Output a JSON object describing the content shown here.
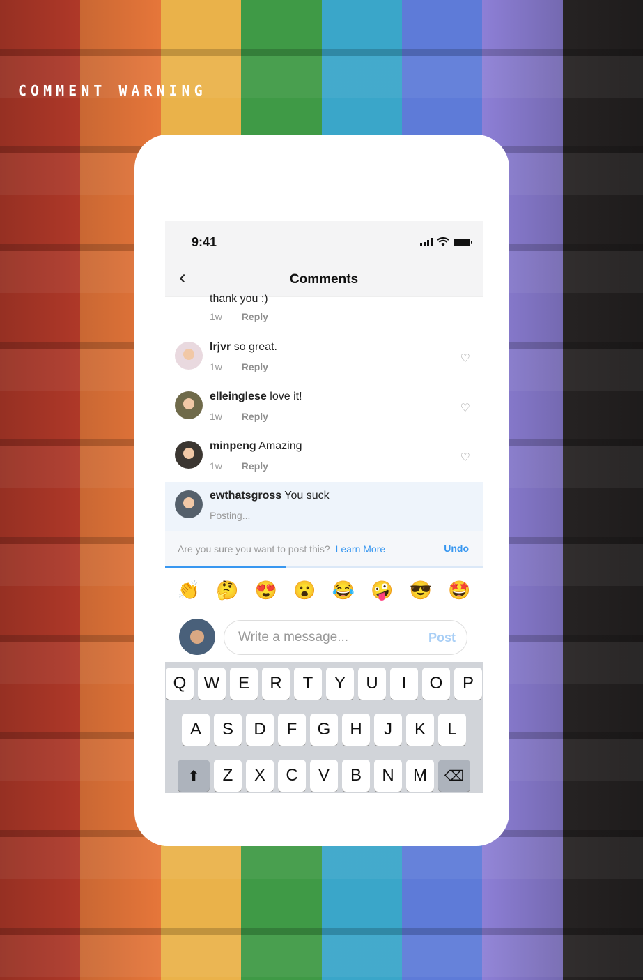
{
  "page": {
    "heading": "COMMENT WARNING"
  },
  "colors": {
    "stripes": [
      "#c8402e",
      "#e6763a",
      "#eab24a",
      "#3f9a46",
      "#3aa6c9",
      "#5e7bd8",
      "#8d7fd6",
      "#2e2a2a"
    ],
    "accent": "#3897f0"
  },
  "phone": {
    "status": {
      "time": "9:41",
      "icons": [
        "signal-icon",
        "wifi-icon",
        "battery-icon"
      ]
    },
    "nav": {
      "title": "Comments",
      "back_icon": "chevron-left-icon"
    },
    "cut_comment": {
      "text": "thank you :)",
      "time": "1w",
      "reply": "Reply"
    },
    "comments": [
      {
        "user": "lrjvr",
        "text": "so great.",
        "time": "1w",
        "reply": "Reply",
        "avatar_color": "#e9d9df"
      },
      {
        "user": "elleinglese",
        "text": "love it!",
        "time": "1w",
        "reply": "Reply",
        "avatar_color": "#6f6a4a"
      },
      {
        "user": "minpeng",
        "text": "Amazing",
        "time": "1w",
        "reply": "Reply",
        "avatar_color": "#3b3631"
      }
    ],
    "pending": {
      "user": "ewthatsgross",
      "text": "You suck",
      "status": "Posting...",
      "avatar_color": "#55606b"
    },
    "warning": {
      "question": "Are you sure you want to post this?",
      "learn_more": "Learn More",
      "undo": "Undo",
      "progress_percent": 38
    },
    "emojis": [
      "👏",
      "🤔",
      "😍",
      "😮",
      "😂",
      "🤪",
      "😎",
      "🤩"
    ],
    "composer": {
      "placeholder": "Write a message...",
      "post": "Post"
    },
    "keyboard": {
      "row1": [
        "Q",
        "W",
        "E",
        "R",
        "T",
        "Y",
        "U",
        "I",
        "O",
        "P"
      ],
      "row2": [
        "A",
        "S",
        "D",
        "F",
        "G",
        "H",
        "J",
        "K",
        "L"
      ],
      "row3": [
        "Z",
        "X",
        "C",
        "V",
        "B",
        "N",
        "M"
      ]
    }
  }
}
